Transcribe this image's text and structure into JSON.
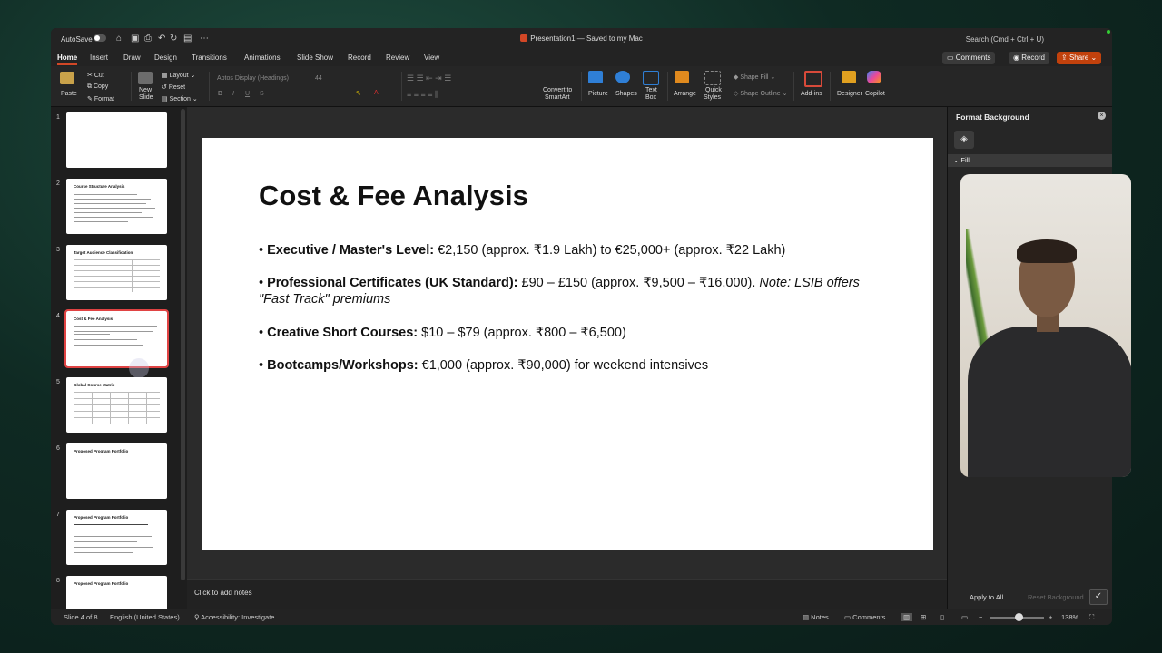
{
  "titlebar": {
    "autosave_label": "AutoSave",
    "doc_title": "Presentation1 — Saved to my Mac",
    "search_placeholder": "Search (Cmd + Ctrl + U)"
  },
  "tabs": [
    "Home",
    "Insert",
    "Draw",
    "Design",
    "Transitions",
    "Animations",
    "Slide Show",
    "Record",
    "Review",
    "View"
  ],
  "active_tab": "Home",
  "header_buttons": {
    "comments": "Comments",
    "record": "Record",
    "share": "Share"
  },
  "ribbon": {
    "paste": "Paste",
    "cut": "Cut",
    "copy": "Copy",
    "format": "Format",
    "new_slide_1": "New",
    "new_slide_2": "Slide",
    "layout": "Layout",
    "reset": "Reset",
    "section": "Section",
    "font_name": "Aptos Display (Headings)",
    "font_size": "44",
    "convert_1": "Convert to",
    "convert_2": "SmartArt",
    "picture": "Picture",
    "shapes": "Shapes",
    "textbox_1": "Text",
    "textbox_2": "Box",
    "arrange": "Arrange",
    "quick_1": "Quick",
    "quick_2": "Styles",
    "shape_fill": "Shape Fill",
    "shape_outline": "Shape Outline",
    "addins": "Add-ins",
    "designer": "Designer",
    "copilot": "Copilot"
  },
  "thumbnails": [
    {
      "num": "1",
      "title": ""
    },
    {
      "num": "2",
      "title": "Course Structure Analysis"
    },
    {
      "num": "3",
      "title": "Target Audience Classification"
    },
    {
      "num": "4",
      "title": "Cost & Fee Analysis"
    },
    {
      "num": "5",
      "title": "Global Course Matrix"
    },
    {
      "num": "6",
      "title": "Proposed Program Portfolio"
    },
    {
      "num": "7",
      "title": "Proposed Program Portfolio"
    },
    {
      "num": "8",
      "title": "Proposed Program Portfolio"
    }
  ],
  "slide": {
    "title": "Cost & Fee Analysis",
    "bullets": [
      {
        "bold": "Executive / Master's Level:",
        "text": " €2,150 (approx. ₹1.9 Lakh) to €25,000+ (approx. ₹22 Lakh)",
        "italic": ""
      },
      {
        "bold": "Professional Certificates (UK Standard):",
        "text": " £90 – £150 (approx. ₹9,500 – ₹16,000).",
        "italic": " Note: LSIB offers \"Fast Track\" premiums"
      },
      {
        "bold": "Creative Short Courses:",
        "text": " $10 – $79 (approx. ₹800 – ₹6,500)",
        "italic": ""
      },
      {
        "bold": "Bootcamps/Workshops:",
        "text": " €1,000 (approx. ₹90,000) for weekend intensives",
        "italic": ""
      }
    ]
  },
  "notes_placeholder": "Click to add notes",
  "format_pane": {
    "title": "Format Background",
    "fill_label": "Fill",
    "apply_all": "Apply to All",
    "reset_bg": "Reset Background"
  },
  "status": {
    "slide_of": "Slide 4 of 8",
    "language": "English (United States)",
    "accessibility": "Accessibility: Investigate",
    "notes": "Notes",
    "comments": "Comments",
    "zoom": "138%"
  }
}
